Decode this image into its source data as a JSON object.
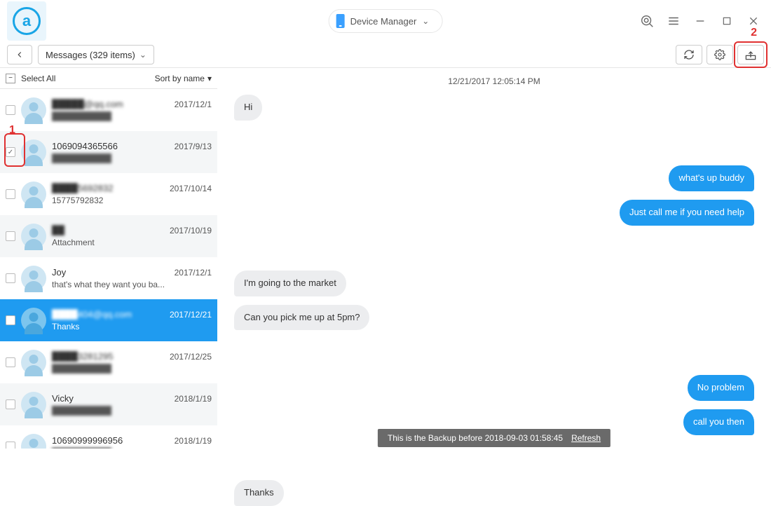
{
  "titlebar": {
    "device_label": "Device Manager"
  },
  "toolbar": {
    "crumb_label": "Messages (329 items)"
  },
  "list_header": {
    "select_all": "Select All",
    "sort_label": "Sort by name"
  },
  "conversations": [
    {
      "name": "█████@qq.com",
      "date": "2017/12/1",
      "preview": "",
      "checked": false,
      "selected": false,
      "blur_name": true,
      "blur_preview": true
    },
    {
      "name": "1069094365566",
      "date": "2017/9/13",
      "preview": "",
      "checked": true,
      "selected": false,
      "blur_name": false,
      "blur_preview": true
    },
    {
      "name": "████5692832",
      "date": "2017/10/14",
      "preview": "15775792832",
      "checked": false,
      "selected": false,
      "blur_name": true,
      "blur_preview": false
    },
    {
      "name": "██",
      "date": "2017/10/19",
      "preview": "Attachment",
      "checked": false,
      "selected": false,
      "blur_name": true,
      "blur_preview": false
    },
    {
      "name": "Joy",
      "date": "2017/12/1",
      "preview": "that's what they want you ba...",
      "checked": false,
      "selected": false,
      "blur_name": false,
      "blur_preview": false
    },
    {
      "name": "████404@qq.com",
      "date": "2017/12/21",
      "preview": "Thanks",
      "checked": false,
      "selected": true,
      "blur_name": true,
      "blur_preview": false
    },
    {
      "name": "████3281295",
      "date": "2017/12/25",
      "preview": "",
      "checked": false,
      "selected": false,
      "blur_name": true,
      "blur_preview": true
    },
    {
      "name": "Vicky",
      "date": "2018/1/19",
      "preview": "",
      "checked": false,
      "selected": false,
      "blur_name": false,
      "blur_preview": true
    },
    {
      "name": "10690999996956",
      "date": "2018/1/19",
      "preview": "",
      "checked": false,
      "selected": false,
      "blur_name": false,
      "blur_preview": true
    }
  ],
  "chat": {
    "date_header": "12/21/2017 12:05:14 PM",
    "messages": [
      {
        "dir": "in",
        "text": "Hi"
      },
      {
        "dir": "out",
        "text": "what's up buddy"
      },
      {
        "dir": "out",
        "text": "Just call me if you need help"
      },
      {
        "dir": "in",
        "text": "I'm going to the market"
      },
      {
        "dir": "in",
        "text": "Can you pick me up at 5pm?"
      },
      {
        "dir": "out",
        "text": "No problem"
      },
      {
        "dir": "out",
        "text": "call you then"
      },
      {
        "dir": "in",
        "text": "Thanks"
      }
    ]
  },
  "backup_bar": {
    "text": "This is the Backup before 2018-09-03 01:58:45",
    "refresh": "Refresh"
  },
  "annotations": {
    "one": "1",
    "two": "2"
  }
}
